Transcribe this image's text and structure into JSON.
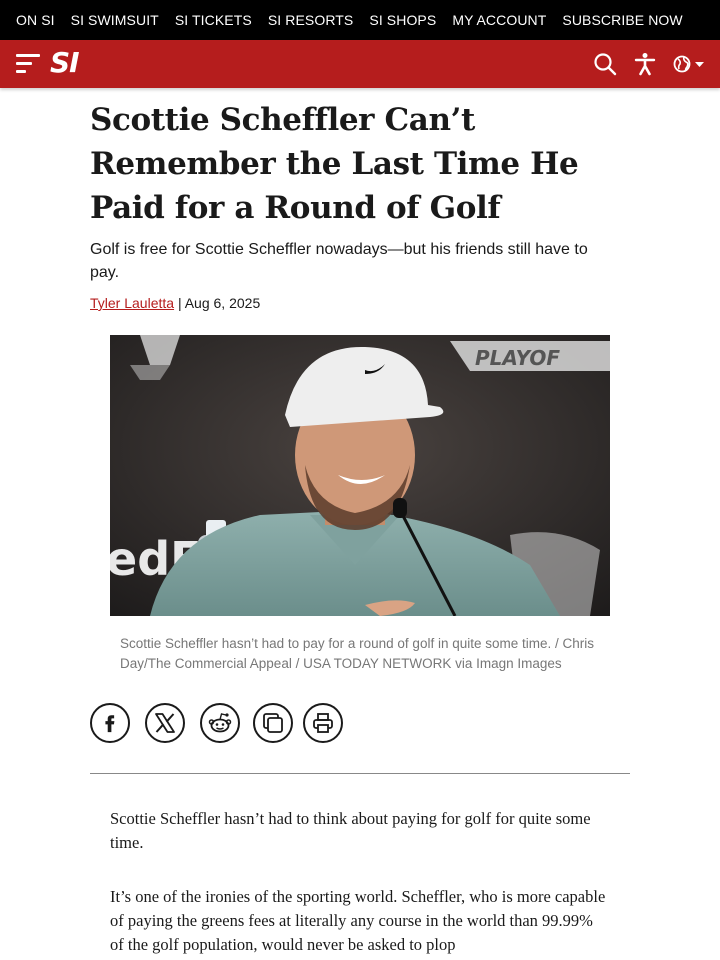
{
  "top_nav": [
    "ON SI",
    "SI SWIMSUIT",
    "SI TICKETS",
    "SI RESORTS",
    "SI SHOPS",
    "MY ACCOUNT",
    "SUBSCRIBE NOW"
  ],
  "header": {
    "logo": "SI",
    "accent_color": "#b51d1d"
  },
  "article": {
    "headline": "Scottie Scheffler Can’t Remember the Last Time He Paid for a Round of Golf",
    "dek": "Golf is free for Scottie Scheffler nowadays—but his friends still have to pay.",
    "author": "Tyler Lauletta",
    "separator": " | ",
    "date": "Aug 6, 2025",
    "caption": "Scottie Scheffler hasn’t had to pay for a round of golf in quite some time. / Chris Day/The Commercial Appeal / USA TODAY NETWORK via Imagn Images",
    "photo_text": {
      "banner": "PLAYOF",
      "sponsor": "edE"
    },
    "share_icons": [
      "facebook-icon",
      "x-icon",
      "reddit-icon",
      "copy-icon",
      "print-icon"
    ],
    "paragraphs": [
      "Scottie Scheffler hasn’t had to think about paying for golf for quite some time.",
      "It’s one of the ironies of the sporting world. Scheffler, who is more capable of paying the greens fees at literally any course in the world than 99.99% of the golf population, would never be asked to plop"
    ]
  }
}
